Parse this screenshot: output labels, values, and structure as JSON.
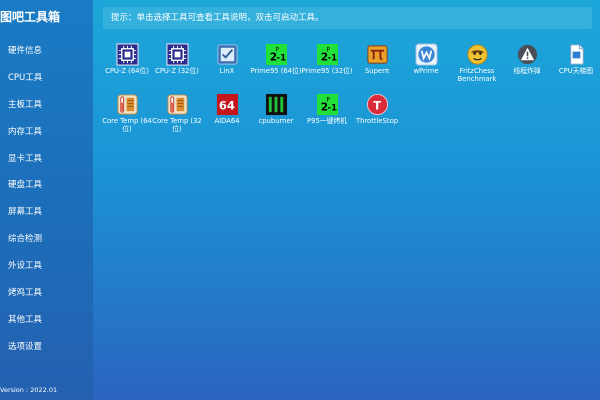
{
  "app_title": "图吧工具箱",
  "sidebar": {
    "items": [
      {
        "label": "硬件信息"
      },
      {
        "label": "CPU工具"
      },
      {
        "label": "主板工具"
      },
      {
        "label": "内存工具"
      },
      {
        "label": "显卡工具"
      },
      {
        "label": "硬盘工具"
      },
      {
        "label": "屏幕工具"
      },
      {
        "label": "综合检测"
      },
      {
        "label": "外设工具"
      },
      {
        "label": "烤鸡工具"
      },
      {
        "label": "其他工具"
      },
      {
        "label": "选项设置"
      }
    ],
    "version": "Version : 2022.01"
  },
  "hint": "提示：单击选择工具可查看工具说明，双击可启动工具。",
  "tools": [
    {
      "label": "CPU-Z (64位)",
      "icon": "cpu-z-icon"
    },
    {
      "label": "CPU-Z (32位)",
      "icon": "cpu-z-icon"
    },
    {
      "label": "LinX",
      "icon": "linx-icon"
    },
    {
      "label": "Prime95 (64位)",
      "icon": "prime95-icon"
    },
    {
      "label": "Prime95 (32位)",
      "icon": "prime95-icon"
    },
    {
      "label": "Superπ",
      "icon": "superpi-icon"
    },
    {
      "label": "wPrime",
      "icon": "wprime-icon"
    },
    {
      "label": "FritzChess Benchmark",
      "icon": "fritzchess-icon"
    },
    {
      "label": "线程炸弹",
      "icon": "warning-icon"
    },
    {
      "label": "CPU天梯图",
      "icon": "document-icon"
    },
    {
      "label": "Core Temp (64位)",
      "icon": "coretemp-icon"
    },
    {
      "label": "Core Temp (32位)",
      "icon": "coretemp-icon"
    },
    {
      "label": "AIDA64",
      "icon": "aida64-icon"
    },
    {
      "label": "cpuburner",
      "icon": "cpuburner-icon"
    },
    {
      "label": "P95一键烤机",
      "icon": "prime95-icon"
    },
    {
      "label": "ThrottleStop",
      "icon": "throttlestop-icon"
    }
  ],
  "icon_text": {
    "aida64": "64",
    "prime_base": "2",
    "prime_p": "P",
    "prime_rest": "-1",
    "throttle": "T"
  }
}
